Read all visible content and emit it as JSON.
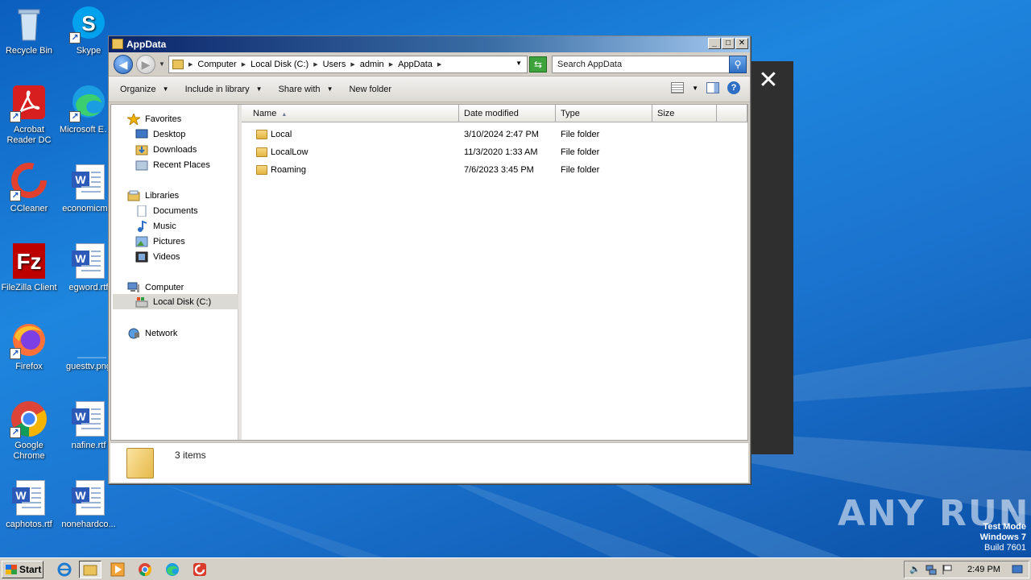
{
  "desktop": {
    "icons": [
      {
        "label": "Recycle Bin",
        "icon": "recycle-bin-icon"
      },
      {
        "label": "Skype",
        "icon": "skype-icon"
      },
      {
        "label": "Acrobat Reader DC",
        "icon": "acrobat-icon"
      },
      {
        "label": "Microsoft Edge",
        "icon": "edge-icon"
      },
      {
        "label": "CCleaner",
        "icon": "ccleaner-icon"
      },
      {
        "label": "economicm...",
        "icon": "word-doc-icon"
      },
      {
        "label": "FileZilla Client",
        "icon": "filezilla-icon"
      },
      {
        "label": "egword.rtf",
        "icon": "word-doc-icon"
      },
      {
        "label": "Firefox",
        "icon": "firefox-icon"
      },
      {
        "label": "guesttv.png",
        "icon": "image-file-icon"
      },
      {
        "label": "Google Chrome",
        "icon": "chrome-icon"
      },
      {
        "label": "nafine.rtf",
        "icon": "word-doc-icon"
      },
      {
        "label": "caphotos.rtf",
        "icon": "word-doc-icon"
      },
      {
        "label": "nonehardco...",
        "icon": "word-doc-icon"
      }
    ]
  },
  "overlay": {
    "close_glyph": "✕"
  },
  "window": {
    "title": "AppData",
    "min_glyph": "_",
    "max_glyph": "□",
    "close_glyph": "✕"
  },
  "address": {
    "crumbs": [
      "Computer",
      "Local Disk (C:)",
      "Users",
      "admin",
      "AppData"
    ],
    "search_placeholder": "Search AppData"
  },
  "toolbar": {
    "organize": "Organize",
    "include_in_library": "Include in library",
    "share_with": "Share with",
    "new_folder": "New folder"
  },
  "nav": {
    "favorites": "Favorites",
    "desktop": "Desktop",
    "downloads": "Downloads",
    "recent_places": "Recent Places",
    "libraries": "Libraries",
    "documents": "Documents",
    "music": "Music",
    "pictures": "Pictures",
    "videos": "Videos",
    "computer": "Computer",
    "local_disk": "Local Disk (C:)",
    "network": "Network"
  },
  "columns": {
    "name": "Name",
    "date_modified": "Date modified",
    "type": "Type",
    "size": "Size"
  },
  "files": [
    {
      "name": "Local",
      "date": "3/10/2024 2:47 PM",
      "type": "File folder"
    },
    {
      "name": "LocalLow",
      "date": "11/3/2020 1:33 AM",
      "type": "File folder"
    },
    {
      "name": "Roaming",
      "date": "7/6/2023 3:45 PM",
      "type": "File folder"
    }
  ],
  "details": {
    "item_count": "3 items"
  },
  "taskbar": {
    "start_label": "Start",
    "clock": "2:49 PM"
  },
  "watermark": {
    "text": "ANY RUN"
  },
  "system": {
    "line1": "Test Mode",
    "line2": "Windows 7",
    "line3": "Build 7601"
  },
  "colors": {
    "accent": "#1a56b8",
    "titlebar": "#0a246a",
    "folder": "#e9c25b"
  }
}
